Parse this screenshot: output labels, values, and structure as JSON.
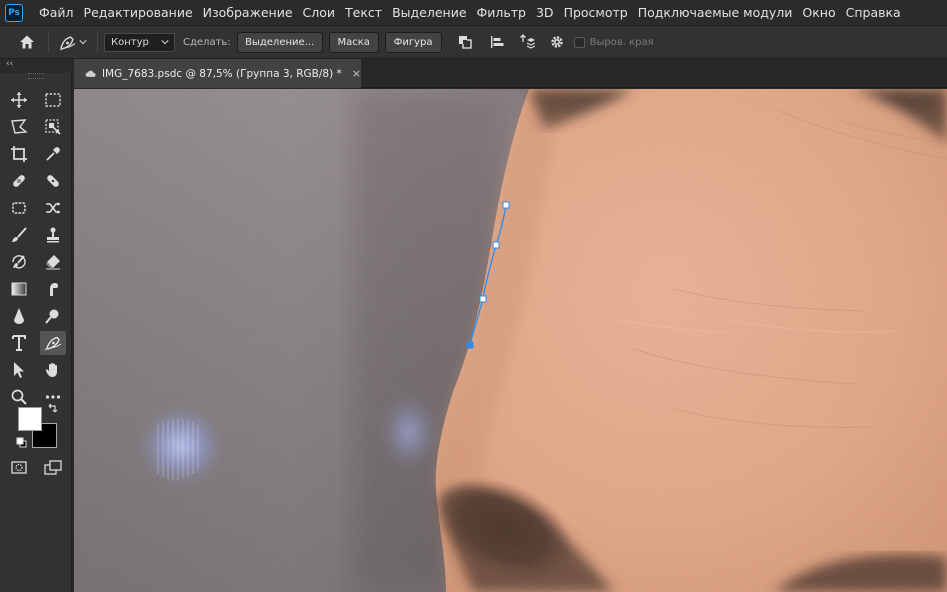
{
  "app": {
    "logo_text": "Ps"
  },
  "menu": [
    "Файл",
    "Редактирование",
    "Изображение",
    "Слои",
    "Текст",
    "Выделение",
    "Фильтр",
    "3D",
    "Просмотр",
    "Подключаемые модули",
    "Окно",
    "Справка"
  ],
  "options_bar": {
    "mode_value": "Контур",
    "make_label": "Сделать:",
    "selection_button": "Выделение...",
    "mask_button": "Маска",
    "shape_button": "Фигура",
    "align_edges_label": "Выров. края",
    "align_edges_checked": false
  },
  "tabs": [
    {
      "title": "IMG_7683.psdc @ 87,5% (Группа 3, RGB/8) *",
      "close": "×",
      "active": true
    }
  ],
  "toolbar": {
    "collapse_glyph": "‹‹",
    "active_tool": "curvature-pen",
    "foreground_color": "#ffffff",
    "background_color": "#000000"
  },
  "colors": {
    "accent_path": "#2d8ceb",
    "skin": "#e6aa88",
    "backdrop": "#8e8486"
  }
}
